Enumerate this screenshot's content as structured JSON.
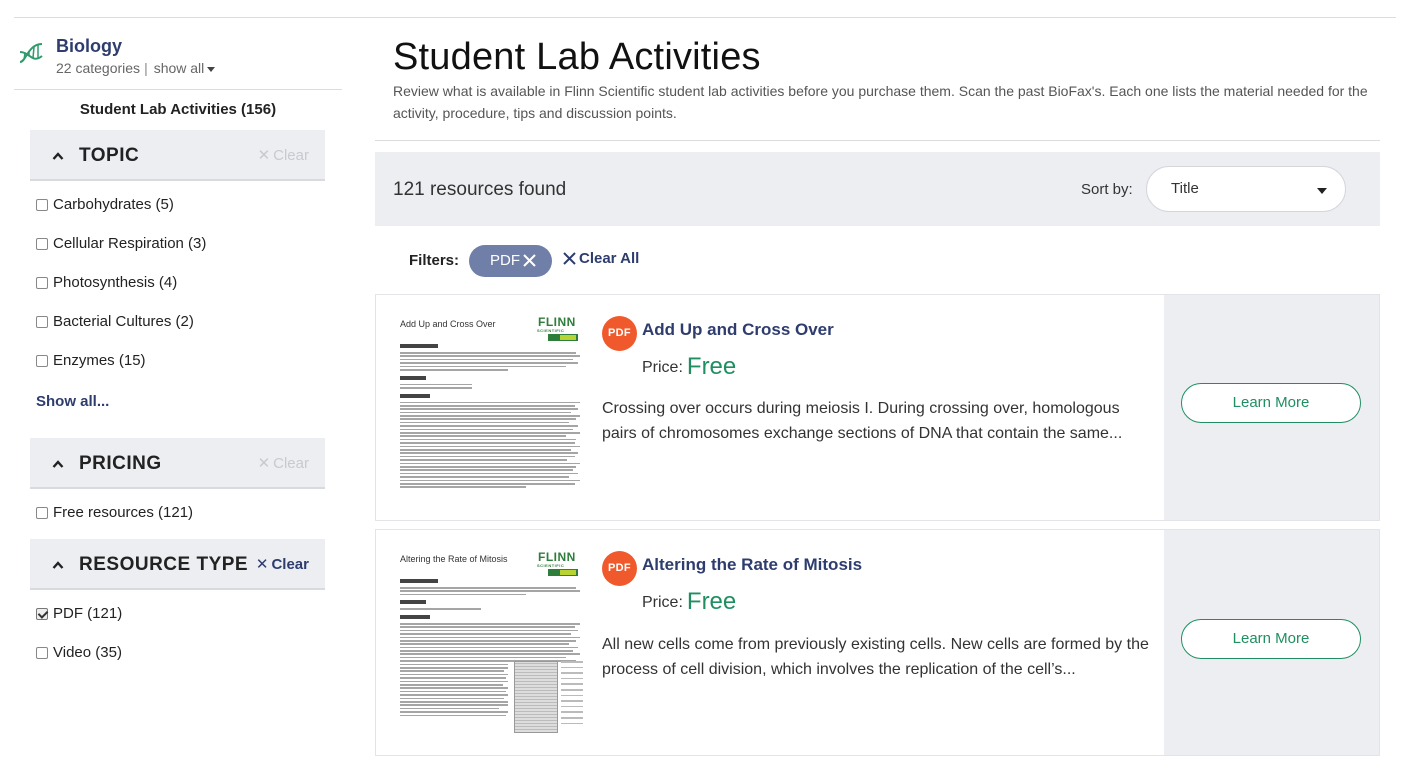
{
  "category": {
    "title": "Biology",
    "count_text": "22 categories",
    "show_all": "show all",
    "icon": "dna-icon"
  },
  "lab_activities_label": "Student Lab Activities (156)",
  "facets": {
    "topic": {
      "title": "TOPIC",
      "clear": "Clear",
      "options": [
        {
          "label": "Carbohydrates (5)",
          "checked": false
        },
        {
          "label": "Cellular Respiration (3)",
          "checked": false
        },
        {
          "label": "Photosynthesis (4)",
          "checked": false
        },
        {
          "label": "Bacterial Cultures (2)",
          "checked": false
        },
        {
          "label": "Enzymes (15)",
          "checked": false
        }
      ],
      "show_all": "Show all..."
    },
    "pricing": {
      "title": "PRICING",
      "clear": "Clear",
      "options": [
        {
          "label": "Free resources (121)",
          "checked": false
        }
      ]
    },
    "resource_type": {
      "title": "RESOURCE TYPE",
      "clear": "Clear",
      "options": [
        {
          "label": "PDF (121)",
          "checked": true
        },
        {
          "label": "Video (35)",
          "checked": false
        }
      ]
    }
  },
  "header": {
    "title": "Student Lab Activities",
    "description": "Review what is available in Flinn Scientific student lab activities before you purchase them. Scan the past BioFax's. Each one lists the material needed for the activity, procedure, tips and discussion points."
  },
  "results": {
    "count_text": "121 resources found",
    "sort_label": "Sort by:",
    "sort_value": "Title"
  },
  "filters": {
    "label": "Filters:",
    "chips": [
      "PDF"
    ],
    "clear_all": "Clear All"
  },
  "cards": [
    {
      "badge": "PDF",
      "title": "Add Up and Cross Over",
      "price_label": "Price:",
      "price_value": "Free",
      "description": "Crossing over occurs during meiosis I. During crossing over, homologous pairs of chromosomes exchange sections of DNA that contain the same...",
      "button": "Learn More",
      "thumb_title": "Add Up and Cross Over",
      "thumb_logo": "FLINN"
    },
    {
      "badge": "PDF",
      "title": "Altering the Rate of Mitosis",
      "price_label": "Price:",
      "price_value": "Free",
      "description": "All new cells come from previously existing cells. New cells are formed by the process of cell division, which involves the replication of the cell’s...",
      "button": "Learn More",
      "thumb_title": "Altering the Rate of Mitosis",
      "thumb_logo": "FLINN"
    }
  ],
  "colors": {
    "brand_navy": "#2e3d6e",
    "accent_green": "#1f8f62",
    "pdf_orange": "#f0592b",
    "chip_blue": "#6f7fa8",
    "panel_gray": "#eceef2"
  }
}
